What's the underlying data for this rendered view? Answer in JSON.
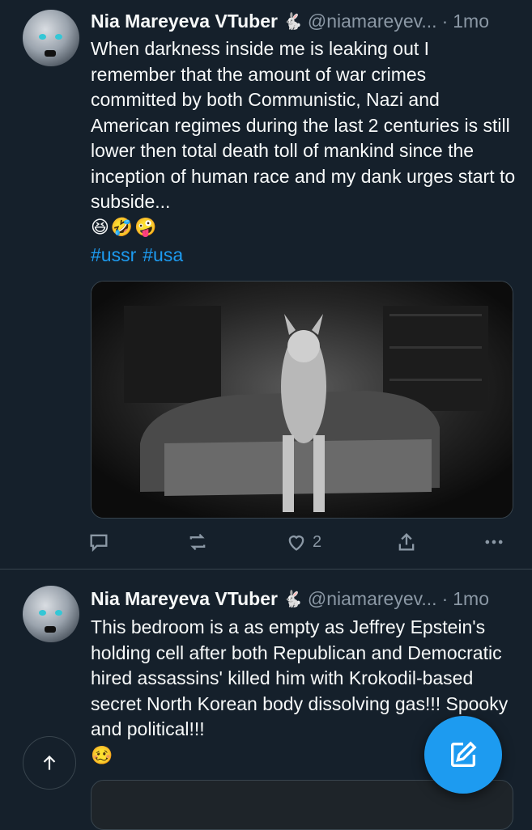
{
  "tweets": [
    {
      "author_name": "Nia Mareyeva VTuber",
      "author_badge": "🐇",
      "handle": "@niamareyev...",
      "separator": "·",
      "time": "1mo",
      "text": "When darkness inside me is leaking out I remember that the amount of war crimes committed by both Communistic, Nazi and American regimes during the last 2 centuries is still lower then total death toll of mankind since the inception of human race and my dank urges start to subside...",
      "emojis": "😆🤣🤪",
      "hashtags": [
        "#ussr",
        "#usa"
      ],
      "like_count": "2"
    },
    {
      "author_name": "Nia Mareyeva VTuber",
      "author_badge": "🐇",
      "handle": "@niamareyev...",
      "separator": "·",
      "time": "1mo",
      "text": "This bedroom is a as empty as Jeffrey Epstein's holding cell after both Republican and Democratic hired assassins' killed him with Krokodil-based secret North Korean body dissolving gas!!! Spooky and political!!!",
      "emojis": "🥴"
    }
  ],
  "icons": {
    "reply": "reply-icon",
    "retweet": "retweet-icon",
    "like": "heart-icon",
    "share": "share-icon",
    "more": "more-icon",
    "scroll_top": "arrow-up-icon",
    "compose": "compose-icon"
  },
  "colors": {
    "background": "#15202b",
    "text": "#f7f9f9",
    "secondary": "#8b98a5",
    "accent": "#1d9bf0",
    "border": "#38444d"
  }
}
